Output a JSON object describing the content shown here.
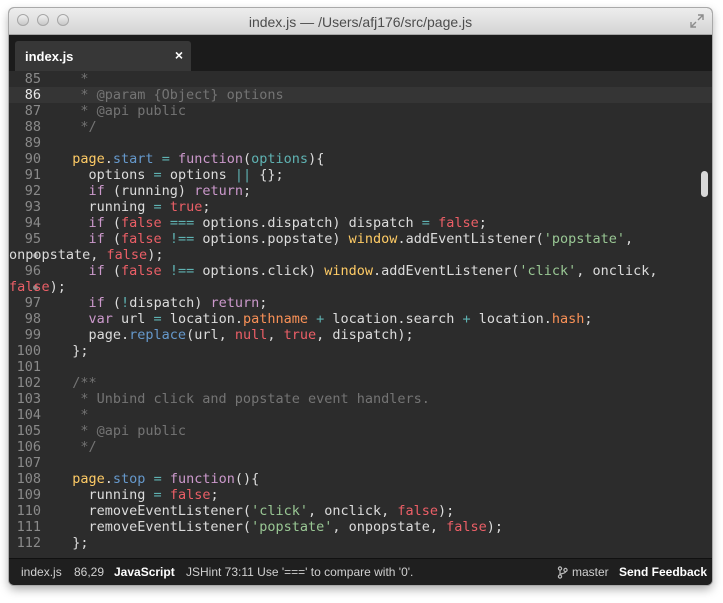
{
  "window": {
    "title": "index.js — /Users/afj176/src/page.js"
  },
  "tab": {
    "label": "index.js",
    "close": "×"
  },
  "editor": {
    "current_line": "86",
    "lines": [
      {
        "n": "85",
        "tokens": [
          [
            "cm",
            "   *"
          ]
        ]
      },
      {
        "n": "86",
        "tokens": [
          [
            "cm",
            "   * @param {Object} options"
          ]
        ]
      },
      {
        "n": "87",
        "tokens": [
          [
            "cm",
            "   * @api public"
          ]
        ]
      },
      {
        "n": "88",
        "tokens": [
          [
            "cm",
            "   */"
          ]
        ]
      },
      {
        "n": "89",
        "tokens": []
      },
      {
        "n": "90",
        "tokens": [
          [
            "text",
            "  "
          ],
          [
            "obj",
            "page"
          ],
          [
            "text",
            "."
          ],
          [
            "fn",
            "start"
          ],
          [
            "text",
            " "
          ],
          [
            "op",
            "="
          ],
          [
            "text",
            " "
          ],
          [
            "kw",
            "function"
          ],
          [
            "text",
            "("
          ],
          [
            "param",
            "options"
          ],
          [
            "text",
            "){"
          ]
        ]
      },
      {
        "n": "91",
        "tokens": [
          [
            "text",
            "    options "
          ],
          [
            "op",
            "="
          ],
          [
            "text",
            " options "
          ],
          [
            "op",
            "||"
          ],
          [
            "text",
            " {};"
          ]
        ]
      },
      {
        "n": "92",
        "tokens": [
          [
            "text",
            "    "
          ],
          [
            "kw",
            "if"
          ],
          [
            "text",
            " (running) "
          ],
          [
            "kw",
            "return"
          ],
          [
            "text",
            ";"
          ]
        ]
      },
      {
        "n": "93",
        "tokens": [
          [
            "text",
            "    running "
          ],
          [
            "op",
            "="
          ],
          [
            "text",
            " "
          ],
          [
            "bool",
            "true"
          ],
          [
            "text",
            ";"
          ]
        ]
      },
      {
        "n": "94",
        "tokens": [
          [
            "text",
            "    "
          ],
          [
            "kw",
            "if"
          ],
          [
            "text",
            " ("
          ],
          [
            "bool",
            "false"
          ],
          [
            "text",
            " "
          ],
          [
            "op",
            "==="
          ],
          [
            "text",
            " options.dispatch) dispatch "
          ],
          [
            "op",
            "="
          ],
          [
            "text",
            " "
          ],
          [
            "bool",
            "false"
          ],
          [
            "text",
            ";"
          ]
        ]
      },
      {
        "n": "95",
        "tokens": [
          [
            "text",
            "    "
          ],
          [
            "kw",
            "if"
          ],
          [
            "text",
            " ("
          ],
          [
            "bool",
            "false"
          ],
          [
            "text",
            " "
          ],
          [
            "op",
            "!=="
          ],
          [
            "text",
            " options.popstate) "
          ],
          [
            "obj",
            "window"
          ],
          [
            "text",
            ".addEventListener("
          ],
          [
            "str",
            "'popstate'"
          ],
          [
            "text",
            ","
          ]
        ]
      },
      {
        "n": "",
        "wrap": true,
        "tokens": [
          [
            "text",
            "onpopstate, "
          ],
          [
            "bool",
            "false"
          ],
          [
            "text",
            ");"
          ]
        ]
      },
      {
        "n": "96",
        "tokens": [
          [
            "text",
            "    "
          ],
          [
            "kw",
            "if"
          ],
          [
            "text",
            " ("
          ],
          [
            "bool",
            "false"
          ],
          [
            "text",
            " "
          ],
          [
            "op",
            "!=="
          ],
          [
            "text",
            " options.click) "
          ],
          [
            "obj",
            "window"
          ],
          [
            "text",
            ".addEventListener("
          ],
          [
            "str",
            "'click'"
          ],
          [
            "text",
            ", onclick,"
          ]
        ]
      },
      {
        "n": "",
        "wrap": true,
        "tokens": [
          [
            "bool",
            "false"
          ],
          [
            "text",
            ");"
          ]
        ]
      },
      {
        "n": "97",
        "tokens": [
          [
            "text",
            "    "
          ],
          [
            "kw",
            "if"
          ],
          [
            "text",
            " ("
          ],
          [
            "op",
            "!"
          ],
          [
            "text",
            "dispatch) "
          ],
          [
            "kw",
            "return"
          ],
          [
            "text",
            ";"
          ]
        ]
      },
      {
        "n": "98",
        "tokens": [
          [
            "text",
            "    "
          ],
          [
            "kw",
            "var"
          ],
          [
            "text",
            " url "
          ],
          [
            "op",
            "="
          ],
          [
            "text",
            " location."
          ],
          [
            "prop",
            "pathname"
          ],
          [
            "text",
            " "
          ],
          [
            "op",
            "+"
          ],
          [
            "text",
            " location.search "
          ],
          [
            "op",
            "+"
          ],
          [
            "text",
            " location."
          ],
          [
            "prop",
            "hash"
          ],
          [
            "text",
            ";"
          ]
        ]
      },
      {
        "n": "99",
        "tokens": [
          [
            "text",
            "    page."
          ],
          [
            "fn",
            "replace"
          ],
          [
            "text",
            "(url, "
          ],
          [
            "bool",
            "null"
          ],
          [
            "text",
            ", "
          ],
          [
            "bool",
            "true"
          ],
          [
            "text",
            ", dispatch);"
          ]
        ]
      },
      {
        "n": "100",
        "tokens": [
          [
            "text",
            "  };"
          ]
        ]
      },
      {
        "n": "101",
        "tokens": []
      },
      {
        "n": "102",
        "tokens": [
          [
            "cm",
            "  /**"
          ]
        ]
      },
      {
        "n": "103",
        "tokens": [
          [
            "cm",
            "   * Unbind click and popstate event handlers."
          ]
        ]
      },
      {
        "n": "104",
        "tokens": [
          [
            "cm",
            "   *"
          ]
        ]
      },
      {
        "n": "105",
        "tokens": [
          [
            "cm",
            "   * @api public"
          ]
        ]
      },
      {
        "n": "106",
        "tokens": [
          [
            "cm",
            "   */"
          ]
        ]
      },
      {
        "n": "107",
        "tokens": []
      },
      {
        "n": "108",
        "tokens": [
          [
            "text",
            "  "
          ],
          [
            "obj",
            "page"
          ],
          [
            "text",
            "."
          ],
          [
            "fn",
            "stop"
          ],
          [
            "text",
            " "
          ],
          [
            "op",
            "="
          ],
          [
            "text",
            " "
          ],
          [
            "kw",
            "function"
          ],
          [
            "text",
            "(){"
          ]
        ]
      },
      {
        "n": "109",
        "tokens": [
          [
            "text",
            "    running "
          ],
          [
            "op",
            "="
          ],
          [
            "text",
            " "
          ],
          [
            "bool",
            "false"
          ],
          [
            "text",
            ";"
          ]
        ]
      },
      {
        "n": "110",
        "tokens": [
          [
            "text",
            "    removeEventListener("
          ],
          [
            "str",
            "'click'"
          ],
          [
            "text",
            ", onclick, "
          ],
          [
            "bool",
            "false"
          ],
          [
            "text",
            ");"
          ]
        ]
      },
      {
        "n": "111",
        "tokens": [
          [
            "text",
            "    removeEventListener("
          ],
          [
            "str",
            "'popstate'"
          ],
          [
            "text",
            ", onpopstate, "
          ],
          [
            "bool",
            "false"
          ],
          [
            "text",
            ");"
          ]
        ]
      },
      {
        "n": "112",
        "tokens": [
          [
            "text",
            "  };"
          ]
        ]
      }
    ]
  },
  "statusbar": {
    "file": "index.js",
    "position": "86,29",
    "language": "JavaScript",
    "message": "JSHint 73:11 Use '===' to compare with '0'.",
    "branch": "master",
    "feedback": "Send Feedback"
  },
  "colors": {
    "background": "#2c2c2c",
    "comment": "#747474",
    "keyword": "#cc99cc",
    "boolean": "#ec5f67",
    "property": "#f99157",
    "object": "#ffcc66",
    "function": "#6699cc",
    "operator": "#5fb3b3",
    "string": "#99c794"
  },
  "icons": [
    "close-traffic-light",
    "minimize-traffic-light",
    "zoom-traffic-light",
    "fullscreen-icon",
    "git-branch-icon"
  ]
}
